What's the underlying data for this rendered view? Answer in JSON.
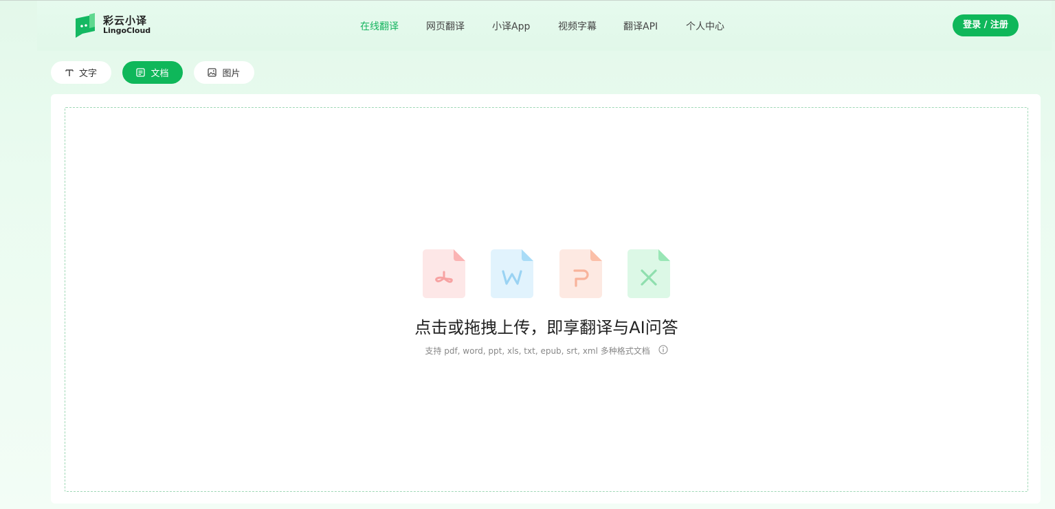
{
  "header": {
    "logo_cn": "彩云小译",
    "logo_en": "LingoCloud",
    "nav": [
      {
        "label": "在线翻译",
        "active": true
      },
      {
        "label": "网页翻译",
        "active": false
      },
      {
        "label": "小译App",
        "active": false
      },
      {
        "label": "视频字幕",
        "active": false
      },
      {
        "label": "翻译API",
        "active": false
      },
      {
        "label": "个人中心",
        "active": false
      }
    ],
    "login_label": "登录 / 注册"
  },
  "mode_tabs": [
    {
      "label": "文字",
      "icon": "text-icon",
      "active": false
    },
    {
      "label": "文档",
      "icon": "document-icon",
      "active": true
    },
    {
      "label": "图片",
      "icon": "image-icon",
      "active": false
    }
  ],
  "upload": {
    "file_types": [
      "pdf-icon",
      "word-icon",
      "ppt-icon",
      "excel-icon"
    ],
    "title": "点击或拖拽上传，即享翻译与AI问答",
    "subtitle": "支持 pdf, word, ppt, xls, txt, epub, srt, xml 多种格式文档"
  },
  "colors": {
    "accent": "#0fb75a",
    "active_nav": "#16b45f",
    "pdf": "#fde7e7",
    "word": "#e1f3fd",
    "ppt": "#fde9e2",
    "excel": "#dcf8e6"
  }
}
